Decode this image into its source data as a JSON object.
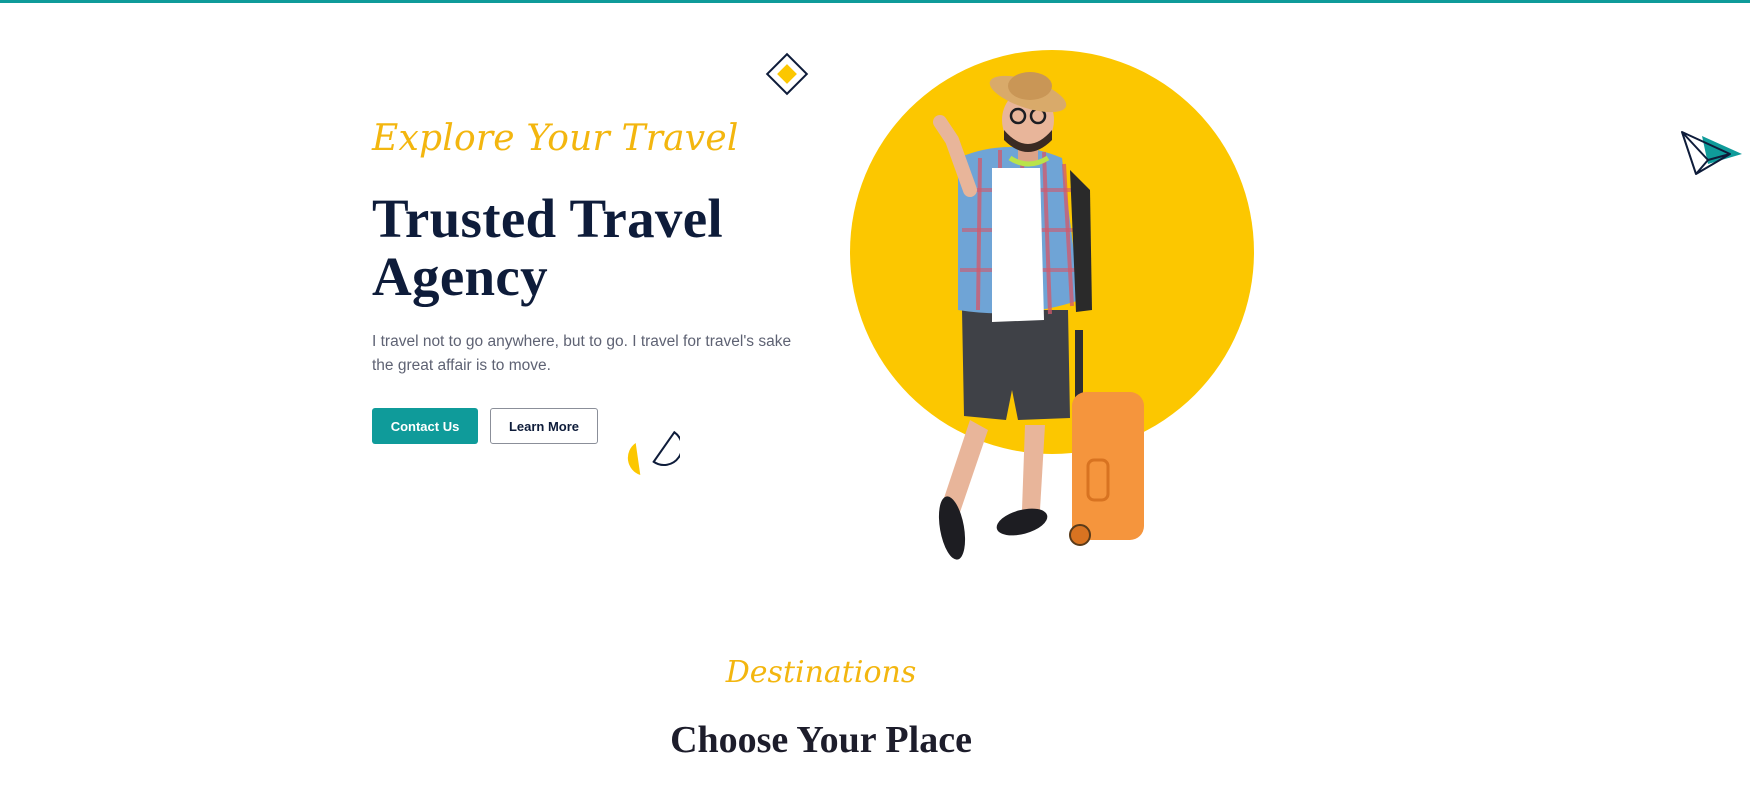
{
  "hero": {
    "kicker": "Explore Your Travel",
    "title": "Trusted Travel Agency",
    "description": "I travel not to go anywhere, but to go. I travel for travel's sake the great affair is to move.",
    "primary_button": "Contact Us",
    "secondary_button": "Learn More"
  },
  "section": {
    "kicker": "Destinations",
    "title": "Choose Your Place"
  },
  "colors": {
    "accent": "#0f9b9a",
    "yellow": "#fcc700",
    "navy": "#0e1c3a",
    "suitcase": "#f5953d"
  },
  "icons": {
    "diamond": "diamond-shape-icon",
    "semicircles": "semicircle-shapes-icon",
    "plane": "paper-plane-icon"
  }
}
